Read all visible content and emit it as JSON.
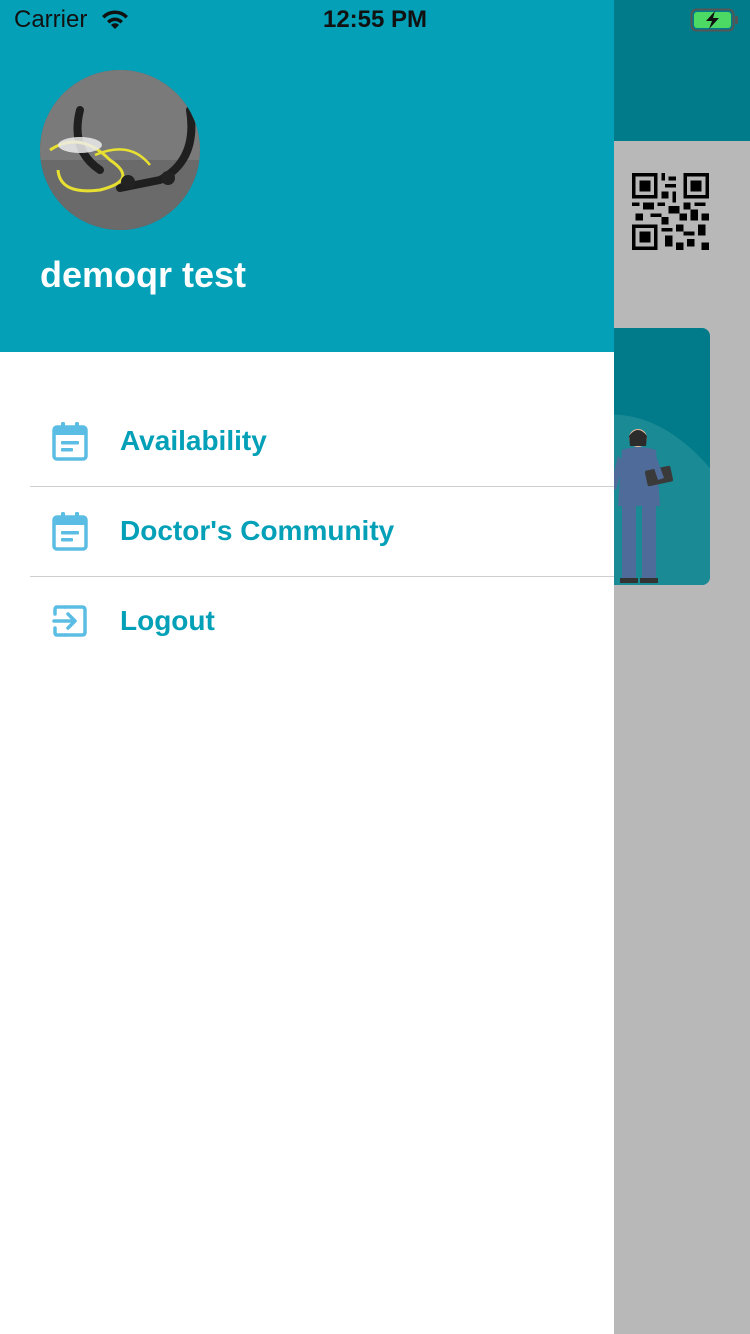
{
  "status_bar": {
    "carrier": "Carrier",
    "time": "12:55 PM"
  },
  "drawer": {
    "user_name": "demoqr test",
    "menu": [
      {
        "label": "Availability",
        "icon": "calendar-icon"
      },
      {
        "label": "Doctor's Community",
        "icon": "calendar-icon"
      },
      {
        "label": "Logout",
        "icon": "logout-icon"
      }
    ]
  },
  "colors": {
    "drawer_header": "#03a0b7",
    "accent": "#03a0b7",
    "menu_icon": "#5bbde4",
    "background_header": "#017b89",
    "overlay": "#b8b8b8"
  }
}
